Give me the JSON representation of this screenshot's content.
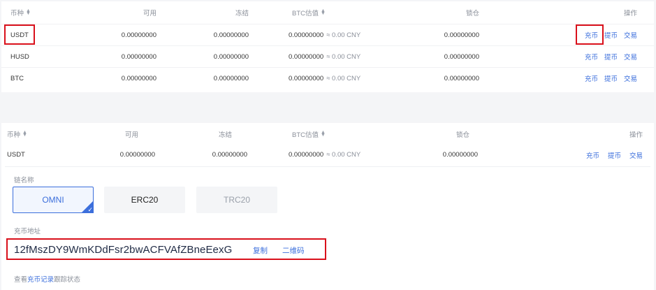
{
  "table1": {
    "headers": {
      "coin": "币种",
      "available": "可用",
      "frozen": "冻结",
      "btc_value": "BTC估值",
      "locked": "锁仓",
      "actions": "操作"
    },
    "rows": [
      {
        "coin": "USDT",
        "available": "0.00000000",
        "frozen": "0.00000000",
        "btc": "0.00000000",
        "cny": "≈ 0.00 CNY",
        "locked": "0.00000000",
        "deposit": "充币",
        "withdraw": "提币",
        "trade": "交易"
      },
      {
        "coin": "HUSD",
        "available": "0.00000000",
        "frozen": "0.00000000",
        "btc": "0.00000000",
        "cny": "≈ 0.00 CNY",
        "locked": "0.00000000",
        "deposit": "充币",
        "withdraw": "提币",
        "trade": "交易"
      },
      {
        "coin": "BTC",
        "available": "0.00000000",
        "frozen": "0.00000000",
        "btc": "0.00000000",
        "cny": "≈ 0.00 CNY",
        "locked": "0.00000000",
        "deposit": "充币",
        "withdraw": "提币",
        "trade": "交易"
      }
    ]
  },
  "table2": {
    "headers": {
      "coin": "币种",
      "available": "可用",
      "frozen": "冻结",
      "btc_value": "BTC估值",
      "locked": "锁仓",
      "actions": "操作"
    },
    "row": {
      "coin": "USDT",
      "available": "0.00000000",
      "frozen": "0.00000000",
      "btc": "0.00000000",
      "cny": "≈ 0.00 CNY",
      "locked": "0.00000000",
      "deposit": "充币",
      "withdraw": "提币",
      "trade": "交易"
    },
    "chain_label": "链名称",
    "chains": [
      {
        "label": "OMNI",
        "state": "selected"
      },
      {
        "label": "ERC20",
        "state": "normal"
      },
      {
        "label": "TRC20",
        "state": "disabled"
      }
    ],
    "address_label": "充币地址",
    "address": "12fMszDY9WmKDdFsr2bwACFVAfZBneEexG",
    "copy": "复制",
    "qrcode": "二维码",
    "track_prefix": "查看",
    "track_link": "充币记录",
    "track_suffix": "跟踪状态"
  },
  "colors": {
    "accent": "#3c6fdc",
    "highlight": "#d9101b"
  }
}
